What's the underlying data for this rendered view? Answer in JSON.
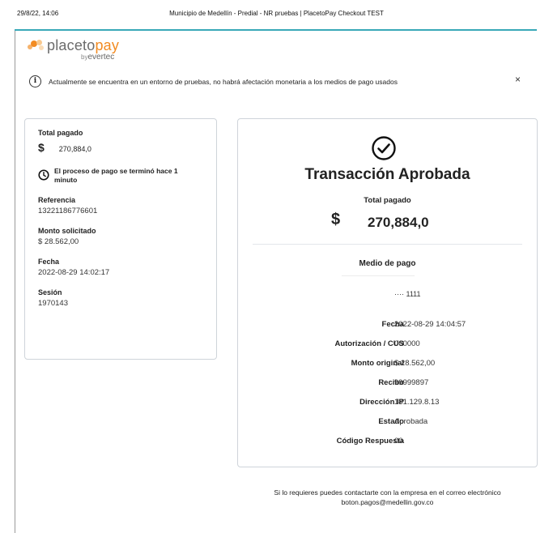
{
  "print_header": {
    "datetime": "29/8/22, 14:06",
    "title": "Municipio de Medellín - Predial - NR pruebas | PlacetoPay Checkout TEST"
  },
  "logo": {
    "part1": "placeto",
    "part2": "pay",
    "sub_by": "by",
    "sub_name": "evertec"
  },
  "notice": {
    "text": "Actualmente se encuentra en un entorno de pruebas, no habrá afectación monetaria a los medios de pago usados",
    "close": "×"
  },
  "summary": {
    "total_label": "Total pagado",
    "currency": "$",
    "total_amount": "270,884,0",
    "process_text": "El proceso de pago se terminó hace 1 minuto",
    "reference_label": "Referencia",
    "reference_value": "13221186776601",
    "amount_label": "Monto solicitado",
    "amount_value": "$ 28.562,00",
    "date_label": "Fecha",
    "date_value": "2022-08-29 14:02:17",
    "session_label": "Sesión",
    "session_value": "1970143"
  },
  "receipt": {
    "title": "Transacción Aprobada",
    "total_label": "Total pagado",
    "currency": "$",
    "total_amount": "270,884,0",
    "payment_method_label": "Medio de pago",
    "card_number": "···· 1111",
    "details": [
      {
        "key": "Fecha",
        "value": "2022-08-29 14:04:57"
      },
      {
        "key": "Autorización / CUS",
        "value": "000000"
      },
      {
        "key": "Monto original",
        "value": "$ 28.562,00"
      },
      {
        "key": "Recibo",
        "value": "99999897"
      },
      {
        "key": "Dirección IP",
        "value": "181.129.8.13"
      },
      {
        "key": "Estado",
        "value": "Aprobada"
      },
      {
        "key": "Código Respuesta",
        "value": "00"
      }
    ]
  },
  "footer": {
    "line1": "Si lo requieres puedes contactarte con la empresa en el correo electrónico",
    "email": "boton.pagos@medellin.gov.co"
  },
  "colors": {
    "accent_rule": "#39a9b8",
    "logo_orange": "#f28b22",
    "logo_gray": "#6c6c6c"
  }
}
